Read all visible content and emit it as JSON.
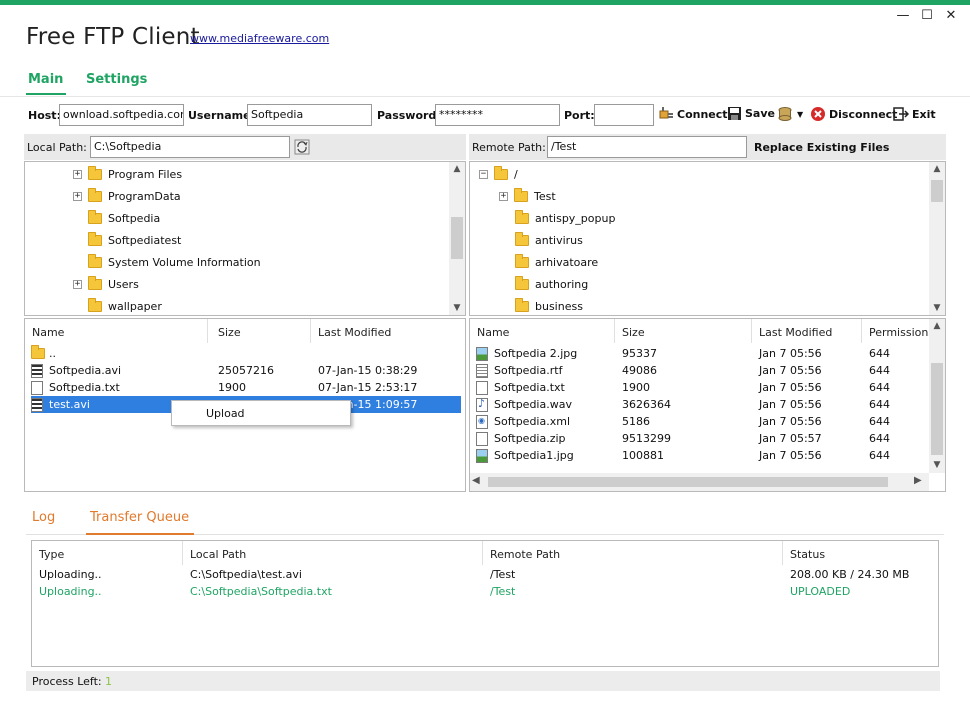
{
  "app": {
    "title": "Free FTP Client",
    "link": "www.mediafreeware.com",
    "accent_color": "#1fa463",
    "window_controls": {
      "minimize": "—",
      "maximize": "☐",
      "close": "✕"
    }
  },
  "tabs": [
    {
      "label": "Main"
    },
    {
      "label": "Settings"
    }
  ],
  "connection": {
    "host_label": "Host:",
    "host_value": "ownload.softpedia.com",
    "username_label": "Username:",
    "username_value": "Softpedia",
    "password_label": "Password:",
    "password_value": "********",
    "port_label": "Port:",
    "port_value": "",
    "connect_label": "Connect",
    "save_label": "Save",
    "disconnect_label": "Disconnect",
    "exit_label": "Exit"
  },
  "local": {
    "path_label": "Local Path:",
    "path_value": "C:\\Softpedia",
    "tree": [
      {
        "label": "Program Files",
        "expandable": true
      },
      {
        "label": "ProgramData",
        "expandable": true
      },
      {
        "label": "Softpedia",
        "expandable": false
      },
      {
        "label": "Softpediatest",
        "expandable": false
      },
      {
        "label": "System Volume Information",
        "expandable": false
      },
      {
        "label": "Users",
        "expandable": true
      },
      {
        "label": "wallpaper",
        "expandable": false
      }
    ],
    "columns": [
      "Name",
      "Size",
      "Last Modified"
    ],
    "files": [
      {
        "name": "..",
        "size": "",
        "modified": "",
        "icon": "folder-icon"
      },
      {
        "name": "Softpedia.avi",
        "size": "25057216",
        "modified": "07-Jan-15 0:38:29",
        "icon": "video-file-icon"
      },
      {
        "name": "Softpedia.txt",
        "size": "1900",
        "modified": "07-Jan-15 2:53:17",
        "icon": "text-file-icon"
      },
      {
        "name": "test.avi",
        "size": "",
        "modified": "07-Jan-15 1:09:57",
        "icon": "video-file-icon"
      }
    ]
  },
  "context_menu": {
    "upload": "Upload"
  },
  "remote": {
    "path_label": "Remote Path:",
    "path_value": "/Test",
    "replace_label": "Replace Existing Files",
    "tree": [
      {
        "label": "/"
      },
      {
        "label": "Test"
      },
      {
        "label": "antispy_popup"
      },
      {
        "label": "antivirus"
      },
      {
        "label": "arhivatoare"
      },
      {
        "label": "authoring"
      },
      {
        "label": "business"
      }
    ],
    "columns": [
      "Name",
      "Size",
      "Last Modified",
      "Permissions"
    ],
    "files": [
      {
        "name": "Softpedia 2.jpg",
        "size": "95337",
        "modified": "Jan  7 05:56",
        "perm": "644",
        "icon": "image-file-icon"
      },
      {
        "name": "Softpedia.rtf",
        "size": "49086",
        "modified": "Jan  7 05:56",
        "perm": "644",
        "icon": "rtf-file-icon"
      },
      {
        "name": "Softpedia.txt",
        "size": "1900",
        "modified": "Jan  7 05:56",
        "perm": "644",
        "icon": "text-file-icon"
      },
      {
        "name": "Softpedia.wav",
        "size": "3626364",
        "modified": "Jan  7 05:56",
        "perm": "644",
        "icon": "audio-file-icon"
      },
      {
        "name": "Softpedia.xml",
        "size": "5186",
        "modified": "Jan  7 05:56",
        "perm": "644",
        "icon": "xml-file-icon"
      },
      {
        "name": "Softpedia.zip",
        "size": "9513299",
        "modified": "Jan  7 05:57",
        "perm": "644",
        "icon": "zip-file-icon"
      },
      {
        "name": "Softpedia1.jpg",
        "size": "100881",
        "modified": "Jan  7 05:56",
        "perm": "644",
        "icon": "image-file-icon"
      }
    ]
  },
  "bottom_tabs": [
    {
      "label": "Log"
    },
    {
      "label": "Transfer Queue"
    }
  ],
  "queue": {
    "columns": [
      "Type",
      "Local Path",
      "Remote Path",
      "Status"
    ],
    "rows": [
      {
        "type": "Uploading..",
        "local": "C:\\Softpedia\\test.avi",
        "remote": "/Test",
        "status": "208.00  KB / 24.30 MB",
        "color": "#111111"
      },
      {
        "type": "Uploading..",
        "local": "C:\\Softpedia\\Softpedia.txt",
        "remote": "/Test",
        "status": "UPLOADED",
        "color": "#1fa463"
      }
    ]
  },
  "status": {
    "process_left_label": "Process Left:",
    "process_left_value": "1"
  }
}
